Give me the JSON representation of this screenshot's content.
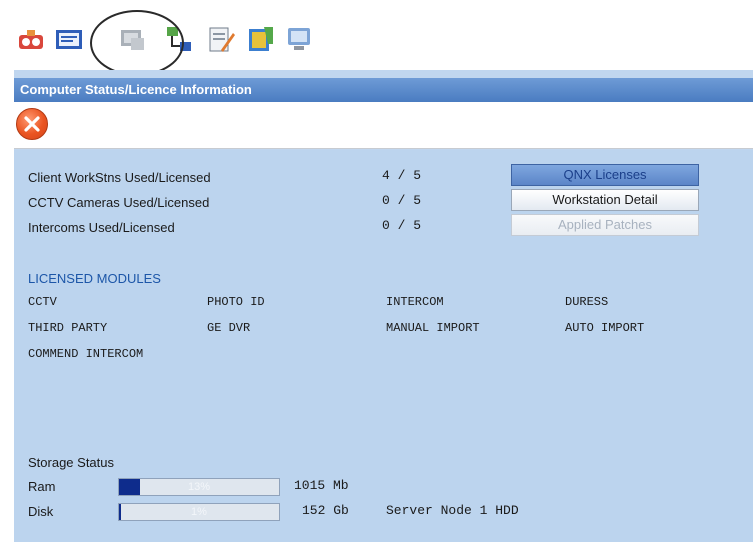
{
  "toolbar": {
    "icons": [
      "alarm-icon",
      "card-reader-icon",
      "computer-status-icon",
      "network-icon",
      "edit-icon",
      "document-icon",
      "monitor-icon"
    ],
    "selected": "computer-status-icon"
  },
  "window": {
    "title": "Computer Status/Licence Information"
  },
  "licences": [
    {
      "label": "Client WorkStns Used/Licensed",
      "value": "4 / 5"
    },
    {
      "label": "CCTV Cameras Used/Licensed",
      "value": "0 / 5"
    },
    {
      "label": "Intercoms Used/Licensed",
      "value": "0 / 5"
    }
  ],
  "buttons": {
    "qnx": "QNX Licenses",
    "workstation": "Workstation Detail",
    "patches": "Applied Patches"
  },
  "modules": {
    "heading": "LICENSED MODULES",
    "items": [
      "CCTV",
      "PHOTO ID",
      "INTERCOM",
      "DURESS",
      "THIRD PARTY",
      "GE DVR",
      "MANUAL IMPORT",
      "AUTO IMPORT",
      "COMMEND INTERCOM"
    ]
  },
  "storage": {
    "heading": "Storage Status",
    "ram": {
      "label": "Ram",
      "percent_text": "13%",
      "fill": 0.13,
      "size": "1015 Mb"
    },
    "disk": {
      "label": "Disk",
      "percent_text": "1%",
      "fill": 0.01,
      "size": "152 Gb",
      "note": "Server Node 1 HDD"
    }
  },
  "colors": {
    "titlebar": "#4a7cc1",
    "panel": "#bcd4ee",
    "bar_fill": "#0e2c8c",
    "close": "#ea5522"
  }
}
